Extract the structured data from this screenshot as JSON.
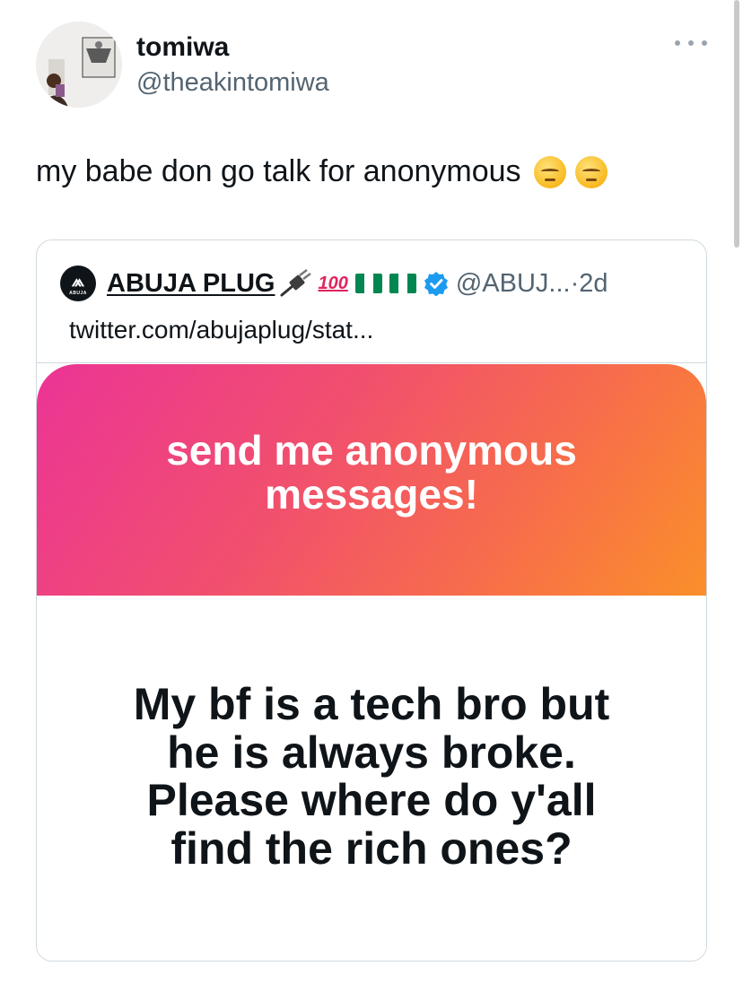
{
  "tweet": {
    "author": {
      "name": "tomiwa",
      "handle": "@theakintomiwa"
    },
    "text": "my babe don go talk for anonymous",
    "emojis": [
      "pensive-face-icon",
      "pensive-face-icon"
    ]
  },
  "quoted_tweet": {
    "avatar_text": "ABUJA",
    "name": "ABUJA PLUG",
    "name_emojis": [
      "electric-plug-icon",
      "hundred-points-icon",
      "nigeria-flag-icon",
      "nigeria-flag-icon"
    ],
    "hundred_text": "100",
    "verified": true,
    "handle": "@ABUJ...",
    "separator": " · ",
    "time": "2d",
    "link": "twitter.com/abujaplug/stat...",
    "image": {
      "banner_text": "send me anonymous messages!",
      "message_text": "My bf is a tech bro but he is always broke. Please where do y'all find the rich ones?"
    }
  },
  "colors": {
    "text": "#0f1419",
    "secondary": "#536471",
    "border": "#cfd9de",
    "verified": "#1d9bf0",
    "banner_gradient": [
      "#ec3496",
      "#f76c4c",
      "#fb8f2a"
    ]
  }
}
